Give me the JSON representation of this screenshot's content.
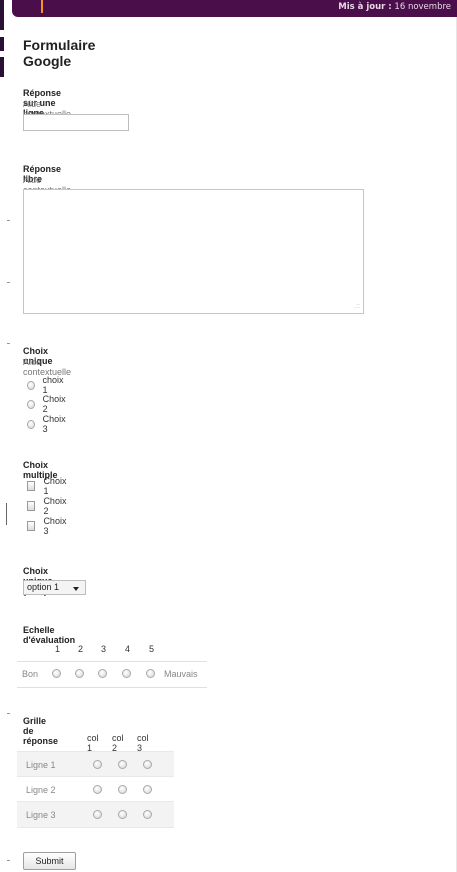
{
  "header": {
    "updated_label": "Mis à jour :",
    "updated_date": "16 novembre"
  },
  "form": {
    "title": "Formulaire Google",
    "q_text": {
      "title": "Réponse sur une ligne",
      "help": "Aide contextuelle",
      "value": ""
    },
    "q_paragraph": {
      "title": "Réponse libre",
      "help": "Aide contextuelle",
      "value": ""
    },
    "q_radio": {
      "title": "Choix unique",
      "help": "Aide contextuelle",
      "options": [
        "choix 1",
        "Choix 2",
        "Choix 3"
      ]
    },
    "q_checkbox": {
      "title": "Choix multiple",
      "options": [
        "Choix 1",
        "Choix 2",
        "Choix 3"
      ]
    },
    "q_list": {
      "title": "Choix unique (liste)",
      "selected": "option 1"
    },
    "q_scale": {
      "title": "Echelle d'évaluation",
      "numbers": [
        "1",
        "2",
        "3",
        "4",
        "5"
      ],
      "low_label": "Bon",
      "high_label": "Mauvais"
    },
    "q_grid": {
      "title": "Grille de réponse",
      "columns": [
        "col 1",
        "col 2",
        "col 3"
      ],
      "rows": [
        "Ligne 1",
        "Ligne 2",
        "Ligne 3"
      ]
    },
    "submit_label": "Submit"
  },
  "colors": {
    "header_bg": "#4a0f4a",
    "accent_orange": "#f7941d"
  }
}
